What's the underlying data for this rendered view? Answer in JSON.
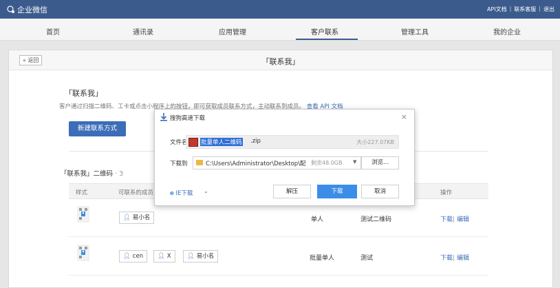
{
  "topbar": {
    "app_name": "企业微信",
    "links": [
      "API文档",
      "联系客服",
      "退出"
    ],
    "separator": "|"
  },
  "nav": {
    "items": [
      "首页",
      "通讯录",
      "应用管理",
      "客户联系",
      "管理工具",
      "我的企业"
    ],
    "active": "客户联系"
  },
  "panel": {
    "back_label": "« 返回",
    "title": "「联系我」"
  },
  "section": {
    "title": "「联系我」",
    "desc_prefix": "客户通过扫描二维码、工卡或点击小程序上的按钮，即可获取成员联系方式，主动联系到成员。",
    "desc_link": "查看 API 文档",
    "new_button": "新建联系方式",
    "count_label": "「联系我」二维码",
    "count_value": "· 3"
  },
  "table": {
    "headers": [
      "样式",
      "可联系的成员",
      "操作"
    ],
    "rows": [
      {
        "members": [
          "易小名"
        ],
        "type": "单人",
        "remark": "测试二维码",
        "download": "下载",
        "edit": "编辑"
      },
      {
        "members": [
          "cen",
          "X",
          "易小名"
        ],
        "type": "批量单人",
        "remark": "测试",
        "download": "下载",
        "edit": "编辑"
      }
    ]
  },
  "dialog": {
    "title": "搜狗高速下载",
    "filename_label": "文件名",
    "filename_selected": "批量单人二维码",
    "filename_ext": ".zip",
    "file_size": "大小227.07KB",
    "saveto_label": "下载到",
    "path": "C:\\Users\\Administrator\\Desktop\\配",
    "free_space": "剩余48.0GB",
    "browse": "浏览...",
    "ie_download": "IE下载",
    "unzip": "解压",
    "download": "下载",
    "cancel": "取消",
    "close": "×"
  },
  "colors": {
    "topbar": "#3b5b8d",
    "accent": "#3b6db8",
    "primary_button": "#3b8de8",
    "selection": "#2f6fd6"
  }
}
